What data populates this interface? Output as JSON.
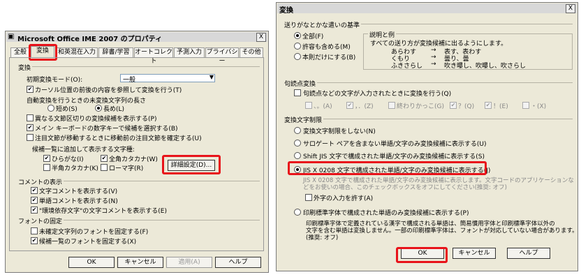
{
  "left": {
    "title": "Microsoft Office IME 2007 のプロパティ",
    "close": "X",
    "tabs": [
      "全般",
      "変換",
      "和英混在入力",
      "辞書/学習",
      "オートコレクト",
      "予測入力",
      "プライバシー",
      "その他"
    ],
    "section_conv": "変換",
    "initial_mode_label": "初期変換モード(O):",
    "initial_mode_value": "一般",
    "cb_cursor": "カーソル位置の前後の内容を参照して変換を行う(T)",
    "auto_len_label": "自動変換を行うときの未変換文字列の長さ",
    "radio_short": "短め(S)",
    "radio_long": "長め(L)",
    "cb_diff_region": "異なる文節区切りの変換候補を表示する(P)",
    "cb_main_keyboard": "メイン キーボードの数字キーで候補を選択する(B)",
    "cb_attention": "注目文節が移動するときに移動前の注目文節を確定する(U)",
    "candidate_types_label": "候補一覧に追加して表示する文字種:",
    "cb_hiragana": "ひらがな(I)",
    "cb_zenkaku_katakana": "全角カタカナ(W)",
    "cb_hankaku_katakana": "半角カタカナ(K)",
    "cb_romaji": "ローマ字(R)",
    "detail_button": "詳細設定(D)...",
    "section_comment": "コメントの表示",
    "cb_text_comment": "文字コメントを表示する(V)",
    "cb_word_comment": "単語コメントを表示する(N)",
    "cb_env_dependent": "\"環境依存文字\"の文字コメントを表示する(E)",
    "section_font": "フォントの固定",
    "cb_unconfirmed_font": "未確定文字列のフォントを固定する(F)",
    "cb_candidate_font": "候補一覧のフォントを固定する(X)",
    "ok": "OK",
    "cancel": "キャンセル",
    "apply": "適用(A)",
    "help": "ヘルプ"
  },
  "right": {
    "title": "変換",
    "close": "X",
    "section_kana": "送りがなとかな遣いの基準",
    "radio_all": "全部(F)",
    "radio_permit": "許容も含める(M)",
    "radio_honsoku": "本則だけにする(B)",
    "example_title": "説明と例",
    "example_desc": "すべての送り方が変換候補に出るようにします。",
    "ex1_kana": "あらわす",
    "ex1_arrow": "→",
    "ex1_kanji": "表す、表わす",
    "ex2_kana": "くもり",
    "ex2_arrow": "→",
    "ex2_kanji": "曇り、曇",
    "ex3_kana": "ふきさらし",
    "ex3_arrow": "→",
    "ex3_kanji": "吹き曝し、吹曝し、吹さらし",
    "section_punct": "句読点変換",
    "cb_punct": "句読点などの文字が入力されたときに変換を行う(Q)",
    "punct_1": "、。(A)",
    "punct_2": "，．(Z)",
    "punct_3": "終わりかっこ(G)",
    "punct_4": "？(Q)",
    "punct_5": "！(E)",
    "punct_6": "・(X)",
    "section_limit": "変換文字制限",
    "r_no_limit": "変換文字制限をしない(N)",
    "r_surrogate": "サロゲート ペアを含まない単語/文字のみ変換候補に表示する(U)",
    "r_shiftjis": "Shift JIS 文字で構成された単語/文字のみ変換候補に表示する(S)",
    "r_jisx0208": "JIS X 0208 文字で構成された単語/文字のみ変換候補に表示する(J)",
    "jis_desc_1": "JIS X 0208 文字で構成された単語/文字のみ変換候補に表示します。文字コードのアプリケーションな",
    "jis_desc_2": "どをお使いの場合、このチェックボックスをオフにしてください(推奨: オフ)",
    "cb_gaiji": "外字の入力を許す(A)",
    "r_print": "印刷標準字体で構成された単語のみ変換候補に表示する(P)",
    "print_desc_1": "印刷標準字体で定義されている漢字で構成される単語は、簡易慣用字体と印刷標準字体以外の",
    "print_desc_2": "文字を含む単語は変換しません。一部の印刷標準字体は、フォントが対応していない場合があります。",
    "print_desc_3": "(推奨: オフ)",
    "ok": "OK",
    "cancel": "キャンセル",
    "help": "ヘルプ"
  },
  "colors": {
    "highlight": "#e8131a",
    "dialog_bg": "#ece9d8"
  }
}
